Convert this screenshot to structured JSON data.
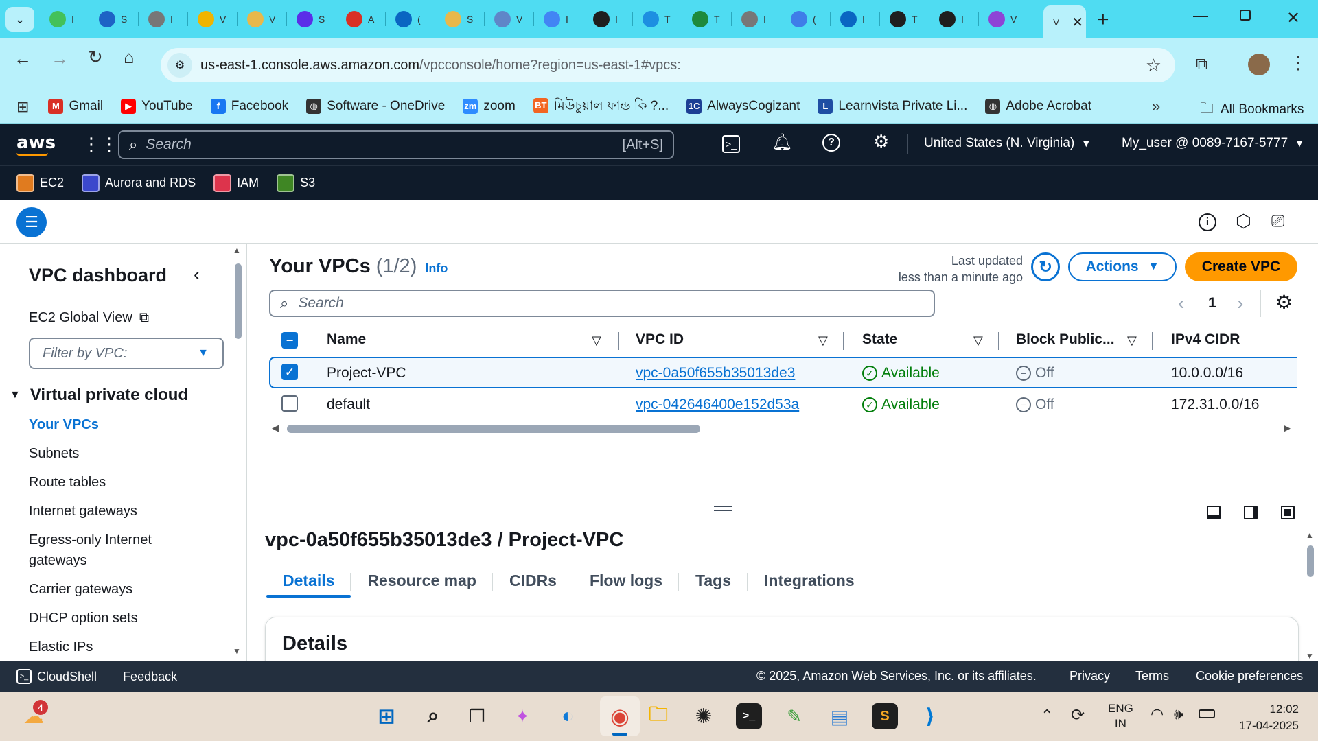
{
  "browser": {
    "tabs": [
      {
        "icon": "chart-icon",
        "color": "#43c15a",
        "short": "I"
      },
      {
        "icon": "aws-icon",
        "color": "#1e63c5",
        "short": "S"
      },
      {
        "icon": "globe-icon",
        "color": "#777777",
        "short": "I"
      },
      {
        "icon": "drive-icon",
        "color": "#f0b400",
        "short": "V"
      },
      {
        "icon": "note-icon",
        "color": "#e8b84b",
        "short": "V"
      },
      {
        "icon": "play-icon",
        "color": "#5b2ee8",
        "short": "S"
      },
      {
        "icon": "gmail-icon",
        "color": "#d93025",
        "short": "A"
      },
      {
        "icon": "linkedin-icon",
        "color": "#0a66c2",
        "short": "("
      },
      {
        "icon": "note-icon",
        "color": "#e8b84b",
        "short": "S"
      },
      {
        "icon": "globe-icon",
        "color": "#5f86c8",
        "short": "V"
      },
      {
        "icon": "google-icon",
        "color": "#4285f4",
        "short": "I"
      },
      {
        "icon": "github-icon",
        "color": "#1f1f1f",
        "short": "I"
      },
      {
        "icon": "docker-icon",
        "color": "#1d8fe1",
        "short": "T"
      },
      {
        "icon": "link-icon",
        "color": "#1e8a3c",
        "short": "T"
      },
      {
        "icon": "globe-icon",
        "color": "#777777",
        "short": "I"
      },
      {
        "icon": "docs-icon",
        "color": "#3f7de8",
        "short": "("
      },
      {
        "icon": "linkedin-icon",
        "color": "#0a66c2",
        "short": "I"
      },
      {
        "icon": "github-icon",
        "color": "#1f1f1f",
        "short": "T"
      },
      {
        "icon": "github-icon",
        "color": "#1f1f1f",
        "short": "I"
      },
      {
        "icon": "app-icon",
        "color": "#8e44d6",
        "short": "V"
      }
    ],
    "active_tab_short": "V",
    "url_domain": "us-east-1.console.aws.amazon.com",
    "url_path": "/vpcconsole/home?region=us-east-1#vpcs:",
    "bookmarks": [
      {
        "label": "Gmail",
        "icon": "gmail-icon",
        "color": "#d93025",
        "glyph": "M"
      },
      {
        "label": "YouTube",
        "icon": "youtube-icon",
        "color": "#ff0000",
        "glyph": "▶"
      },
      {
        "label": "Facebook",
        "icon": "facebook-icon",
        "color": "#1877f2",
        "glyph": "f"
      },
      {
        "label": "Software - OneDrive",
        "icon": "globe-icon",
        "color": "#333333",
        "glyph": "◍"
      },
      {
        "label": "zoom",
        "icon": "zoom-icon",
        "color": "#2d8cff",
        "glyph": "zm"
      },
      {
        "label": "মিউচুয়াল ফান্ড কি ?...",
        "icon": "bt-icon",
        "color": "#f26522",
        "glyph": "BT"
      },
      {
        "label": "AlwaysCogizant",
        "icon": "one-c-icon",
        "color": "#1c3f94",
        "glyph": "1C"
      },
      {
        "label": "Learnvista Private Li...",
        "icon": "learnvista-icon",
        "color": "#1f4ea3",
        "glyph": "L"
      },
      {
        "label": "Adobe Acrobat",
        "icon": "globe-icon",
        "color": "#333333",
        "glyph": "◍"
      }
    ],
    "all_bookmarks": "All Bookmarks"
  },
  "aws": {
    "search_placeholder": "Search",
    "search_shortcut": "[Alt+S]",
    "region": "United States (N. Virginia)",
    "account": "My_user @ 0089-7167-5777",
    "favorites": [
      {
        "label": "EC2",
        "color": "#e07b1f",
        "icon": "ec2-icon"
      },
      {
        "label": "Aurora and RDS",
        "color": "#3b48cc",
        "icon": "rds-icon"
      },
      {
        "label": "IAM",
        "color": "#dd344c",
        "icon": "iam-icon"
      },
      {
        "label": "S3",
        "color": "#3f8624",
        "icon": "s3-icon"
      }
    ]
  },
  "sidebar": {
    "title": "VPC dashboard",
    "global_view": "EC2 Global View",
    "filter_placeholder": "Filter by VPC:",
    "section": "Virtual private cloud",
    "items": [
      "Your VPCs",
      "Subnets",
      "Route tables",
      "Internet gateways",
      "Egress-only Internet",
      "gateways",
      "Carrier gateways",
      "DHCP option sets",
      "Elastic IPs"
    ]
  },
  "main": {
    "title": "Your VPCs",
    "count": "(1/2)",
    "info": "Info",
    "last_updated": "Last updated",
    "last_updated_sub": "less than a minute ago",
    "actions": "Actions",
    "create": "Create VPC",
    "search_placeholder": "Search",
    "page": "1",
    "columns": [
      "Name",
      "VPC ID",
      "State",
      "Block Public...",
      "IPv4 CIDR"
    ],
    "rows": [
      {
        "name": "Project-VPC",
        "id": "vpc-0a50f655b35013de3",
        "state": "Available",
        "block": "Off",
        "cidr": "10.0.0.0/16",
        "selected": true
      },
      {
        "name": "default",
        "id": "vpc-042646400e152d53a",
        "state": "Available",
        "block": "Off",
        "cidr": "172.31.0.0/16",
        "selected": false
      }
    ]
  },
  "split": {
    "title": "vpc-0a50f655b35013de3 / Project-VPC",
    "tabs": [
      "Details",
      "Resource map",
      "CIDRs",
      "Flow logs",
      "Tags",
      "Integrations"
    ],
    "section": "Details"
  },
  "footer": {
    "cloudshell": "CloudShell",
    "feedback": "Feedback",
    "copyright": "© 2025, Amazon Web Services, Inc. or its affiliates.",
    "privacy": "Privacy",
    "terms": "Terms",
    "cookies": "Cookie preferences"
  },
  "taskbar": {
    "weather_badge": "4",
    "lang1": "ENG",
    "lang2": "IN",
    "time": "12:02",
    "date": "17-04-2025"
  }
}
